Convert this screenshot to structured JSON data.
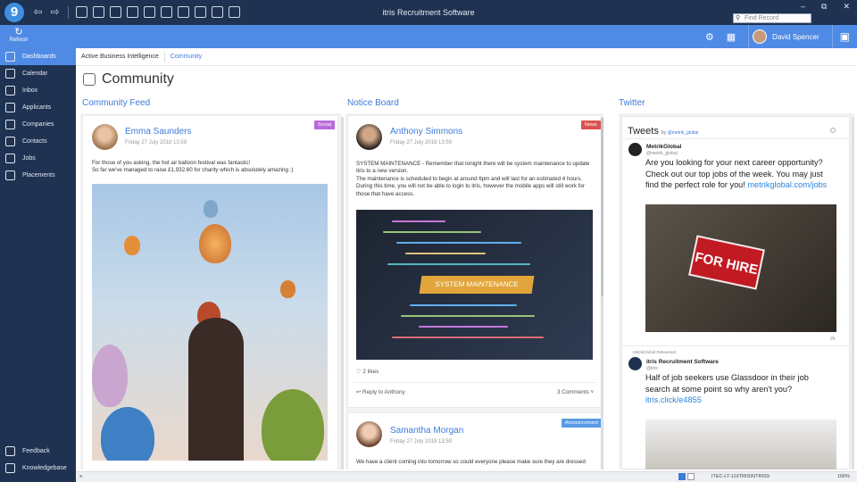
{
  "app": {
    "logo": "9",
    "title": "itris Recruitment Software",
    "find_placeholder": "Find Record",
    "win_controls": [
      "–",
      "⧉",
      "✕"
    ]
  },
  "ribbon": {
    "refresh": "Refresh",
    "user": "David Spencer"
  },
  "sidebar": {
    "items": [
      {
        "label": "Dashboards",
        "icon": "dashboard-icon"
      },
      {
        "label": "Calendar",
        "icon": "calendar-icon"
      },
      {
        "label": "Inbox",
        "icon": "inbox-icon"
      },
      {
        "label": "Applicants",
        "icon": "applicants-icon"
      },
      {
        "label": "Companies",
        "icon": "companies-icon"
      },
      {
        "label": "Contacts",
        "icon": "contacts-icon"
      },
      {
        "label": "Jobs",
        "icon": "jobs-icon"
      },
      {
        "label": "Placements",
        "icon": "placements-icon"
      }
    ],
    "bottom": [
      {
        "label": "Feedback",
        "icon": "lightbulb-icon"
      },
      {
        "label": "Knowledgebase",
        "icon": "book-icon"
      }
    ]
  },
  "breadcrumb": {
    "first": "Active Business Intelligence",
    "second": "Community"
  },
  "page": {
    "title": "Community"
  },
  "columns": {
    "feed": "Community Feed",
    "notice": "Notice Board",
    "twitter": "Twitter"
  },
  "feed_post": {
    "name": "Emma Saunders",
    "date": "Friday 27 July 2018    13:59",
    "tag": "Social",
    "text1": "For those of you asking, the hot air balloon festival was fantastic!",
    "text2": "So far we've managed to raise £1,932.60 for charity which is absolutely amazing :)"
  },
  "notice_post": {
    "name": "Anthony Simmons",
    "date": "Friday 27 July 2018    13:59",
    "tag": "News",
    "lines": [
      "SYSTEM MAINTENANCE - Remember that tonight there will be system maintenance to update",
      "itris to a new version.",
      "The maintenance is scheduled to begin at around 6pm and will last for an estimated 4 hours.",
      "During this time, you will not be able to login to itris, however the mobile apps will still work for",
      "those that have access."
    ],
    "banner": "SYSTEM MAINTENANCE",
    "likes": "2 likes",
    "reply": "Reply to Anthony",
    "comments": "3 Comments"
  },
  "notice_post2": {
    "name": "Samantha Morgan",
    "date": "Friday 27 July 2018    13:59",
    "tag": "Announcement",
    "text": "We have a client coming into tomorrow so could everyone please make sure they are dressed"
  },
  "twitter": {
    "heading": "Tweets",
    "by": "by",
    "handle": "@metrik_global",
    "tweet1": {
      "name": "MetrikGlobal",
      "handle": "@metrik_global",
      "lines": [
        "Are you looking for your next career opportunity?",
        "Check out our top jobs of the week. You may just",
        "find the perfect role for you! "
      ],
      "link": "metrikglobal.com/jobs",
      "sign": "FOR HIRE",
      "time": "2h"
    },
    "tweet2": {
      "retweet": "MetrikGlobal Retweeted",
      "name": "itris Recruitment Software",
      "handle": "@itris",
      "lines": [
        "Half of job seekers use Glassdoor in their job",
        "search at some point so why aren't you?"
      ],
      "link": "itris.click/e4855"
    }
  },
  "status": {
    "left": "≡",
    "itec": "ITEC-LT-11\\ITRIS9\\ITRIS9",
    "zoom": "100%"
  },
  "colors": {
    "navy": "#1f3251",
    "blue": "#4f8ae5",
    "link": "#3d7bd9",
    "social": "#b96ad9",
    "news": "#d9534f",
    "announce": "#5b9be6"
  }
}
